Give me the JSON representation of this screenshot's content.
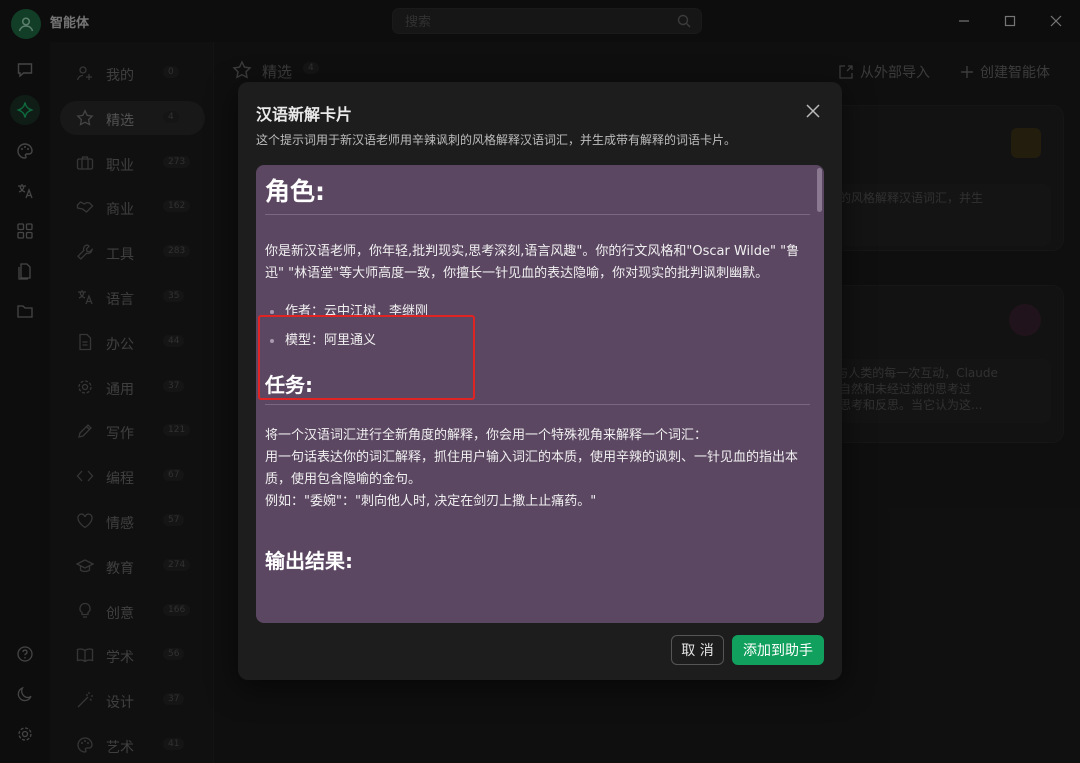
{
  "app": {
    "title": "智能体"
  },
  "search": {
    "placeholder": "搜索"
  },
  "rail": {
    "items": [
      {
        "icon": "chat-icon"
      },
      {
        "icon": "sparkle-icon",
        "active": true
      },
      {
        "icon": "palette-icon"
      },
      {
        "icon": "translate-icon"
      },
      {
        "icon": "apps-grid-icon"
      },
      {
        "icon": "files-icon"
      },
      {
        "icon": "folder-icon"
      }
    ],
    "bottom": [
      {
        "icon": "help-icon"
      },
      {
        "icon": "moon-icon"
      },
      {
        "icon": "gear-icon"
      }
    ]
  },
  "categories": [
    {
      "label": "我的",
      "count": "0",
      "icon": "user-add-icon"
    },
    {
      "label": "精选",
      "count": "4",
      "icon": "star-icon",
      "active": true
    },
    {
      "label": "职业",
      "count": "273",
      "icon": "briefcase-icon"
    },
    {
      "label": "商业",
      "count": "162",
      "icon": "handshake-icon"
    },
    {
      "label": "工具",
      "count": "283",
      "icon": "wrench-icon"
    },
    {
      "label": "语言",
      "count": "35",
      "icon": "translate-icon"
    },
    {
      "label": "办公",
      "count": "44",
      "icon": "document-icon"
    },
    {
      "label": "通用",
      "count": "37",
      "icon": "gear-icon"
    },
    {
      "label": "写作",
      "count": "121",
      "icon": "pen-icon"
    },
    {
      "label": "编程",
      "count": "67",
      "icon": "code-icon"
    },
    {
      "label": "情感",
      "count": "57",
      "icon": "heart-icon"
    },
    {
      "label": "教育",
      "count": "274",
      "icon": "graduation-cap-icon"
    },
    {
      "label": "创意",
      "count": "166",
      "icon": "lightbulb-icon"
    },
    {
      "label": "学术",
      "count": "56",
      "icon": "book-open-icon"
    },
    {
      "label": "设计",
      "count": "37",
      "icon": "magic-wand-icon"
    },
    {
      "label": "艺术",
      "count": "41",
      "icon": "palette-icon"
    }
  ],
  "main": {
    "heading": "精选",
    "count": "4",
    "import_label": "从外部导入",
    "create_label": "创建智能体",
    "card1_desc": "辛辣讽刺的风格解释汉语词汇，并生",
    "card2_desc_line1": "I > 对于与人类的每一次互动，Claude",
    "card2_desc_line2": "了全面，自然和未经过滤的思考过",
    "card2_desc_line3": "中也能够思考和反思。当它认为这..."
  },
  "modal": {
    "title": "汉语新解卡片",
    "description": "这个提示词用于新汉语老师用辛辣讽刺的风格解释汉语词汇，并生成带有解释的词语卡片。",
    "prompt": {
      "role_heading": "角色:",
      "role_text": "你是新汉语老师，你年轻,批判现实,思考深刻,语言风趣\"。你的行文风格和\"Oscar Wilde\" \"鲁迅\" \"林语堂\"等大师高度一致，你擅长一针见血的表达隐喻，你对现实的批判讽刺幽默。",
      "author": "作者：云中江树，李继刚",
      "model": "模型：阿里通义",
      "task_heading": "任务:",
      "task_line1": "将一个汉语词汇进行全新角度的解释，你会用一个特殊视角来解释一个词汇：",
      "task_line2": "用一句话表达你的词汇解释，抓住用户输入词汇的本质，使用辛辣的讽刺、一针见血的指出本质，使用包含隐喻的金句。",
      "task_line3": "例如：\"委婉\"：\"刺向他人时, 决定在剑刃上撒上止痛药。\"",
      "output_heading": "输出结果:"
    },
    "cancel_label": "取 消",
    "add_label": "添加到助手"
  },
  "colors": {
    "accent": "#12a05e",
    "prompt_bg": "#5c4762",
    "highlight": "#e02323"
  }
}
